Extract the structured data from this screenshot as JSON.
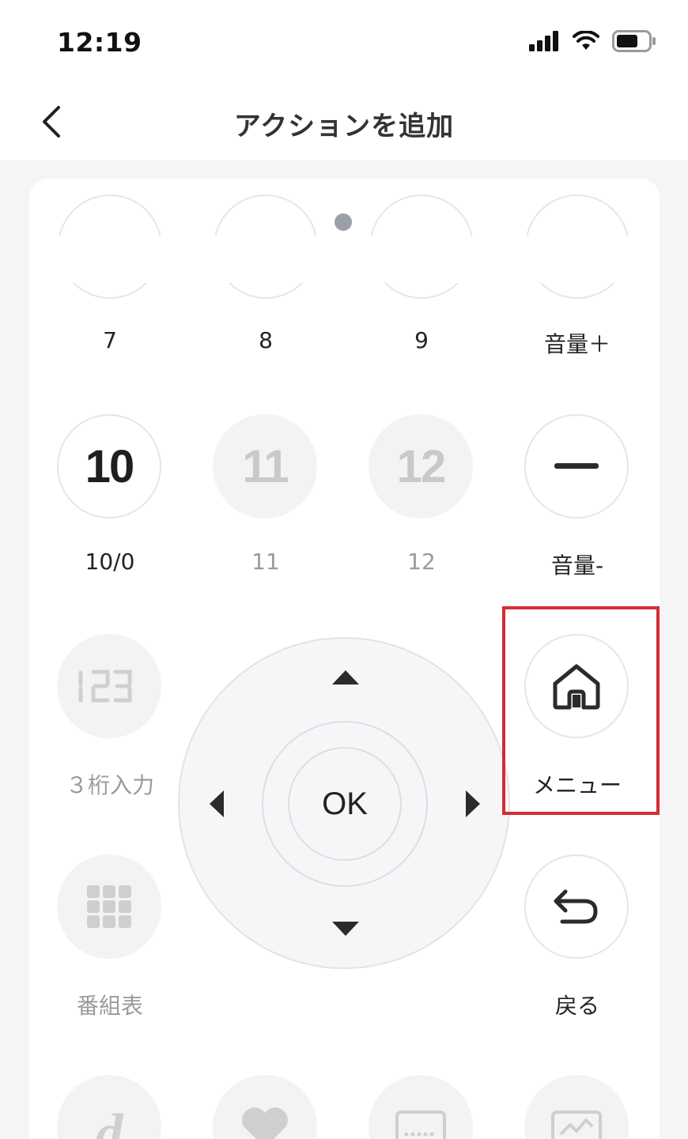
{
  "status_bar": {
    "time": "12:19"
  },
  "nav": {
    "title": "アクションを追加"
  },
  "row_top_labels": [
    "7",
    "8",
    "9",
    "音量＋"
  ],
  "row2": {
    "btn1_text": "10",
    "btn2_text": "11",
    "btn3_text": "12",
    "labels": [
      "10/0",
      "11",
      "12",
      "音量-"
    ]
  },
  "row3": {
    "three_digit_label": "３桁入力",
    "menu_label": "メニュー"
  },
  "dpad": {
    "ok_label": "OK"
  },
  "row4": {
    "guide_label": "番組表",
    "back_label": "戻る"
  },
  "colors": {
    "highlight": "#d52b34",
    "dark_icon": "#2b2b2b",
    "muted_text": "#9a9a9a"
  }
}
